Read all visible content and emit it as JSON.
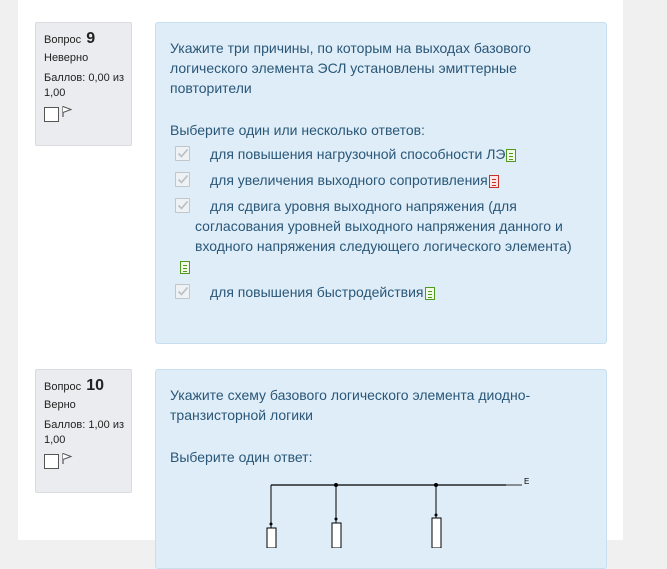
{
  "questions": [
    {
      "label": "Вопрос",
      "number": "9",
      "state": "Неверно",
      "grade": "Баллов: 0,00 из 1,00",
      "text": "Укажите три причины, по которым на выходах базового логического элемента ЭСЛ установлены эмиттерные повторители",
      "prompt": "Выберите один или несколько ответов:",
      "answers": [
        {
          "text": "для повышения нагрузочной способности ЛЭ",
          "checked": true,
          "result": "correct"
        },
        {
          "text": "для увеличения выходного сопротивления",
          "checked": true,
          "result": "incorrect"
        },
        {
          "text": "для сдвига уровня выходного напряжения (для согласования уровней выходного напряжения данного и входного напряжения следующего логического элемента)",
          "checked": true,
          "result": "correct"
        },
        {
          "text": "для повышения быстродействия",
          "checked": true,
          "result": "correct"
        }
      ]
    },
    {
      "label": "Вопрос",
      "number": "10",
      "state": "Верно",
      "grade": "Баллов: 1,00 из 1,00",
      "text": "Укажите схему базового логического элемента диодно-транзисторной логики",
      "prompt": "Выберите один ответ:",
      "diagram_label": "E"
    }
  ],
  "icons": {
    "flag": "flag-icon",
    "check": "check-icon",
    "correct": "correct-mark-icon",
    "incorrect": "incorrect-mark-icon"
  },
  "colors": {
    "content_bg": "#deedf7",
    "text": "#2a5778",
    "info_bg": "#eaecef",
    "correct": "#4d9a1e",
    "incorrect": "#c9302c"
  }
}
